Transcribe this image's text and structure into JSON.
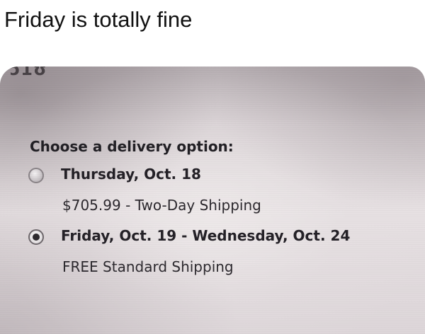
{
  "caption": "Friday is totally fine",
  "photo": {
    "cutoff_text": "ɔ1ʊ",
    "delivery": {
      "heading": "Choose a delivery option:",
      "options": [
        {
          "date": "Thursday, Oct. 18",
          "detail": "$705.99 - Two-Day Shipping",
          "selected": false
        },
        {
          "date": "Friday, Oct. 19 - Wednesday, Oct. 24",
          "detail": "FREE Standard Shipping",
          "selected": true
        }
      ]
    }
  }
}
